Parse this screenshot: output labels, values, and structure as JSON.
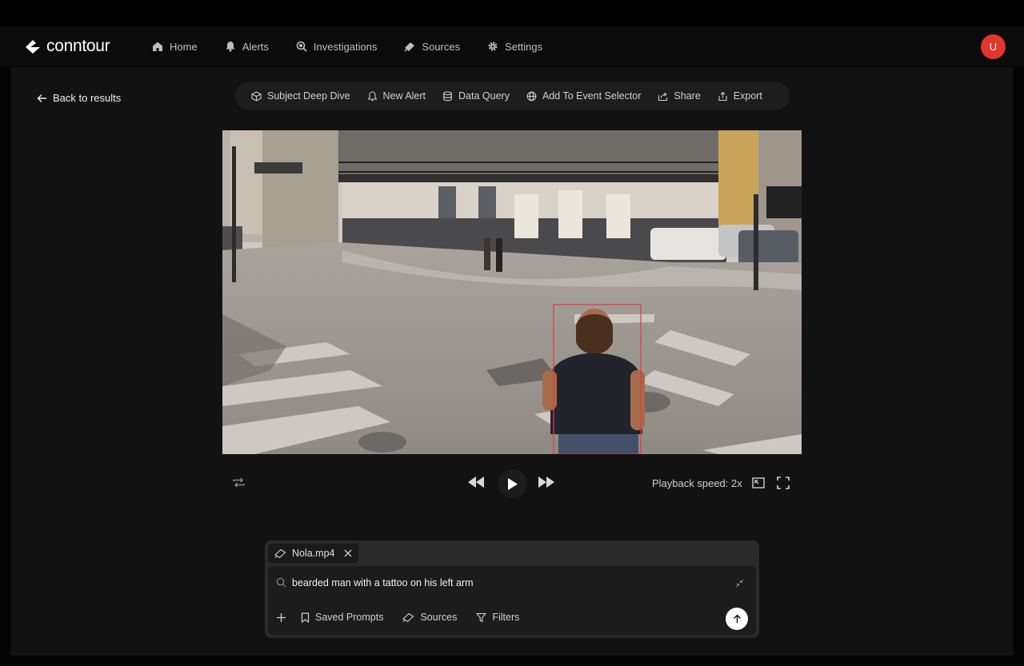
{
  "app": {
    "logo_text": "conntour",
    "user_initial": "U"
  },
  "nav": {
    "items": [
      {
        "label": "Home",
        "icon": "home-icon"
      },
      {
        "label": "Alerts",
        "icon": "bell-icon"
      },
      {
        "label": "Investigations",
        "icon": "investigation-icon"
      },
      {
        "label": "Sources",
        "icon": "sources-icon"
      },
      {
        "label": "Settings",
        "icon": "gear-icon"
      }
    ]
  },
  "back": {
    "label": "Back to results"
  },
  "toolbar": {
    "items": [
      {
        "label": "Subject Deep Dive",
        "icon": "cube-icon"
      },
      {
        "label": "New Alert",
        "icon": "bell-icon"
      },
      {
        "label": "Data Query",
        "icon": "database-icon"
      },
      {
        "label": "Add To Event Selector",
        "icon": "globe-icon"
      },
      {
        "label": "Share",
        "icon": "share-icon"
      },
      {
        "label": "Export",
        "icon": "export-icon"
      }
    ]
  },
  "player": {
    "playback_speed_label": "Playback speed: 2x",
    "detection_box_color": "#e23b3b"
  },
  "search": {
    "chip_label": "Nola.mp4",
    "query": "bearded man with a tattoo on his left arm",
    "saved_prompts_label": "Saved Prompts",
    "sources_label": "Sources",
    "filters_label": "Filters"
  },
  "colors": {
    "accent": "#e2372a",
    "panel": "#121212",
    "navbar": "#0b0b0b"
  }
}
